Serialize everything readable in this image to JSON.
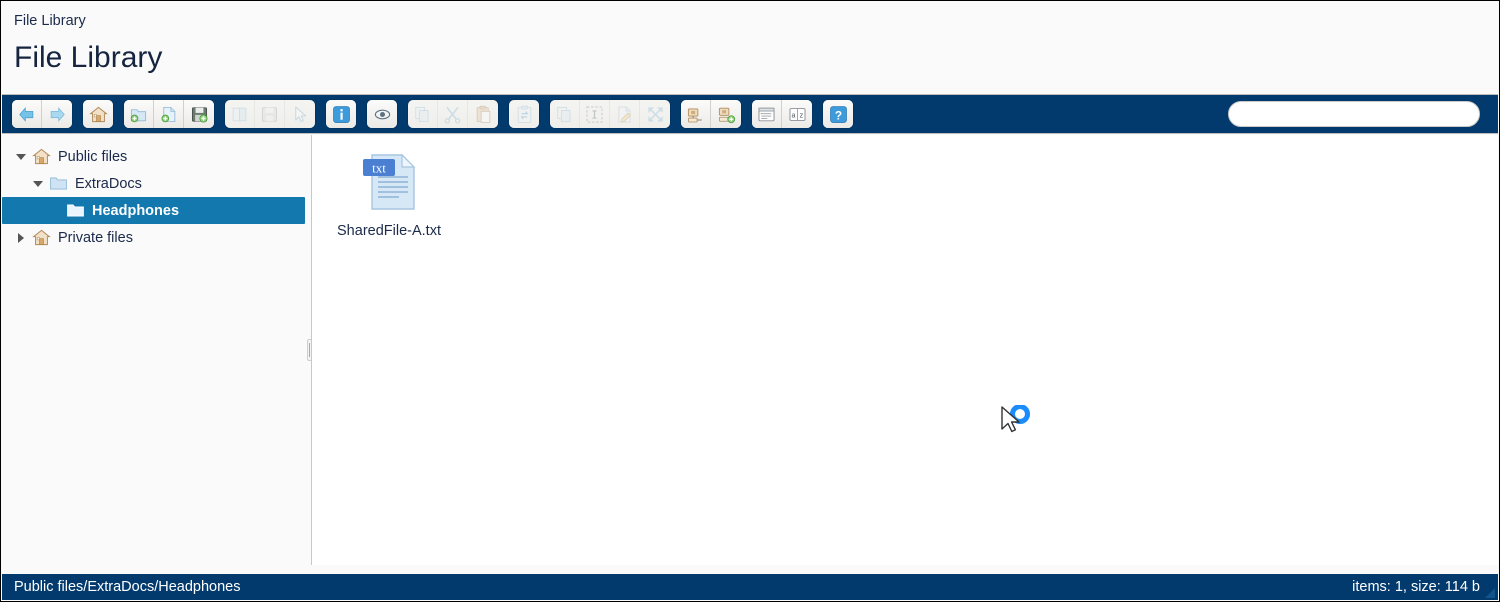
{
  "window": {
    "breadcrumb": "File Library",
    "title": "File Library"
  },
  "colors": {
    "toolbar_bg": "#033a6d",
    "status_bg": "#033a6d",
    "selection_blue": "#1278ad",
    "text_navy": "#1b2a4a",
    "sidebar_bg": "#fafafa",
    "content_bg": "#ffffff"
  },
  "toolbar": {
    "groups": [
      {
        "name": "navigation",
        "buttons": [
          {
            "name": "back-button",
            "icon": "arrow-left-icon",
            "label": "Back",
            "enabled": true
          },
          {
            "name": "forward-button",
            "icon": "arrow-right-icon",
            "label": "Forward",
            "enabled": true
          }
        ]
      },
      {
        "name": "home",
        "buttons": [
          {
            "name": "home-button",
            "icon": "home-icon",
            "label": "Home",
            "enabled": true
          }
        ]
      },
      {
        "name": "create",
        "buttons": [
          {
            "name": "new-folder-button",
            "icon": "folder-add-icon",
            "label": "New folder",
            "enabled": true
          },
          {
            "name": "new-file-button",
            "icon": "file-add-icon",
            "label": "New file",
            "enabled": true
          },
          {
            "name": "upload-button",
            "icon": "floppy-add-icon",
            "label": "Upload",
            "enabled": true
          }
        ]
      },
      {
        "name": "file-ops",
        "buttons": [
          {
            "name": "open-button",
            "icon": "open-book-icon",
            "label": "Open",
            "enabled": false
          },
          {
            "name": "save-button",
            "icon": "floppy-icon",
            "label": "Save",
            "enabled": false
          },
          {
            "name": "select-button",
            "icon": "pointer-icon",
            "label": "Select",
            "enabled": false
          }
        ]
      },
      {
        "name": "info",
        "buttons": [
          {
            "name": "info-button",
            "icon": "info-icon",
            "label": "Info",
            "enabled": true
          }
        ]
      },
      {
        "name": "preview",
        "buttons": [
          {
            "name": "preview-button",
            "icon": "eye-icon",
            "label": "Preview",
            "enabled": true
          }
        ]
      },
      {
        "name": "clipboard",
        "buttons": [
          {
            "name": "copy-button",
            "icon": "copy-icon",
            "label": "Copy",
            "enabled": false
          },
          {
            "name": "cut-button",
            "icon": "scissors-icon",
            "label": "Cut",
            "enabled": false
          },
          {
            "name": "paste-button",
            "icon": "clipboard-paste-icon",
            "label": "Paste",
            "enabled": false
          }
        ]
      },
      {
        "name": "duplicate",
        "buttons": [
          {
            "name": "duplicate-button",
            "icon": "clipboard-sync-icon",
            "label": "Duplicate",
            "enabled": false
          }
        ]
      },
      {
        "name": "edit-ops",
        "buttons": [
          {
            "name": "copy-files-button",
            "icon": "multi-copy-icon",
            "label": "Copy files",
            "enabled": false
          },
          {
            "name": "select-all-button",
            "icon": "select-all-icon",
            "label": "Select all",
            "enabled": false
          },
          {
            "name": "rename-button",
            "icon": "rename-pencil-icon",
            "label": "Rename",
            "enabled": false
          },
          {
            "name": "expand-button",
            "icon": "expand-arrows-icon",
            "label": "Expand",
            "enabled": false
          }
        ]
      },
      {
        "name": "archive",
        "buttons": [
          {
            "name": "extract-archive-button",
            "icon": "archive-icon",
            "label": "Extract archive",
            "enabled": true
          },
          {
            "name": "create-archive-button",
            "icon": "archive-add-icon",
            "label": "Create archive",
            "enabled": true
          }
        ]
      },
      {
        "name": "view",
        "buttons": [
          {
            "name": "view-mode-button",
            "icon": "window-list-icon",
            "label": "View mode",
            "enabled": true
          },
          {
            "name": "sort-button",
            "icon": "sort-az-icon",
            "label": "Sort",
            "enabled": true
          }
        ]
      },
      {
        "name": "help",
        "buttons": [
          {
            "name": "help-button",
            "icon": "question-mark-icon",
            "label": "Help",
            "enabled": true
          }
        ]
      }
    ]
  },
  "search": {
    "value": "",
    "placeholder": ""
  },
  "sidebar": {
    "tree": [
      {
        "name": "tree-item-public-files",
        "label": "Public files",
        "icon": "home-folder-icon",
        "depth": 0,
        "expanded": true,
        "hasChildren": true,
        "selected": false
      },
      {
        "name": "tree-item-extradocs",
        "label": "ExtraDocs",
        "icon": "folder-icon",
        "depth": 1,
        "expanded": true,
        "hasChildren": true,
        "selected": false
      },
      {
        "name": "tree-item-headphones",
        "label": "Headphones",
        "icon": "folder-icon",
        "depth": 2,
        "expanded": false,
        "hasChildren": false,
        "selected": true
      },
      {
        "name": "tree-item-private-files",
        "label": "Private files",
        "icon": "home-folder-icon",
        "depth": 0,
        "expanded": false,
        "hasChildren": true,
        "selected": false
      }
    ],
    "splitter": "panel-splitter"
  },
  "content": {
    "files": [
      {
        "name": "file-tile-sharedfile-a",
        "label": "SharedFile-A.txt",
        "icon": "txt-file-icon",
        "badge": "txt"
      }
    ],
    "cursor": "loading-cursor"
  },
  "statusbar": {
    "path": "Public files/ExtraDocs/Headphones",
    "info": "items: 1, size: 114 b"
  }
}
